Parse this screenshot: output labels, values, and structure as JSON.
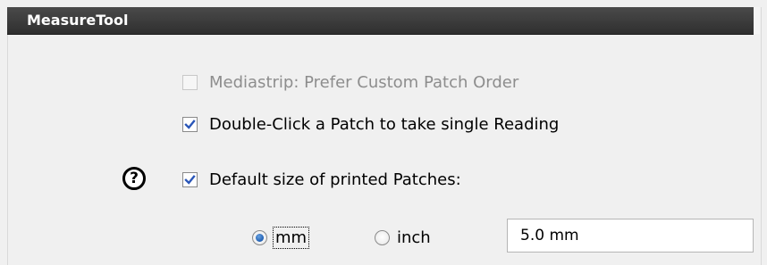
{
  "header": {
    "title": "MeasureTool"
  },
  "options": {
    "mediastrip": {
      "label": "Mediastrip: Prefer Custom Patch Order",
      "checked": false,
      "enabled": false
    },
    "double_click": {
      "label": "Double-Click a Patch to take single Reading",
      "checked": true,
      "enabled": true
    },
    "default_size": {
      "label": "Default size of printed Patches:",
      "checked": true,
      "enabled": true
    }
  },
  "help": {
    "glyph": "?",
    "icon": "help-icon"
  },
  "units": {
    "mm": {
      "label": "mm",
      "selected": true
    },
    "inch": {
      "label": "inch",
      "selected": false
    }
  },
  "size_field": {
    "value": "5.0 mm"
  }
}
